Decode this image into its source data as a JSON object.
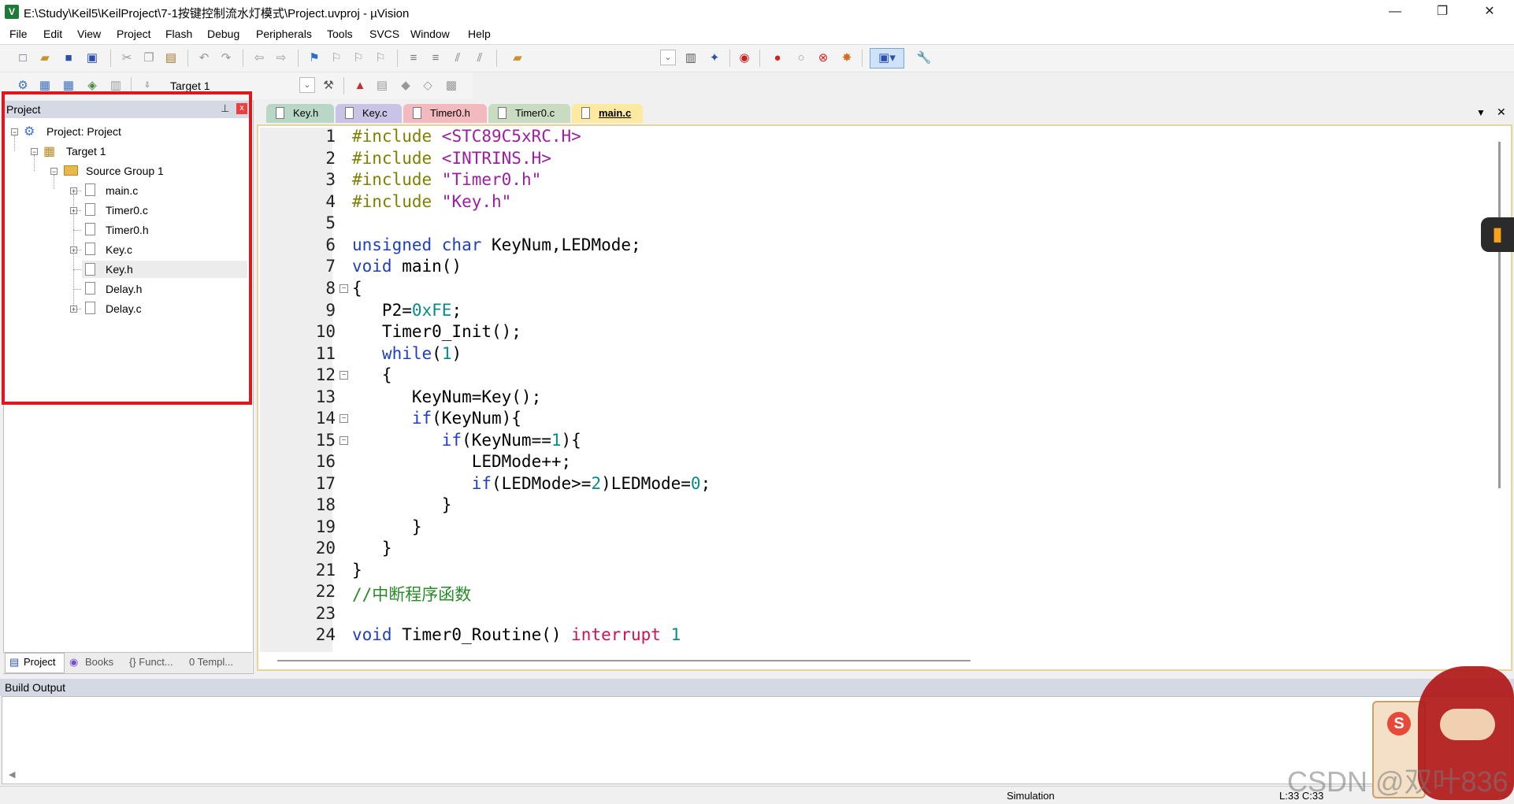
{
  "window": {
    "title": "E:\\Study\\Keil5\\KeilProject\\7-1按键控制流水灯模式\\Project.uvproj - µVision",
    "icon_label": "V",
    "minimize": "—",
    "restore": "❐",
    "close": "✕"
  },
  "menu": [
    "File",
    "Edit",
    "View",
    "Project",
    "Flash",
    "Debug",
    "Peripherals",
    "Tools",
    "SVCS",
    "Window",
    "Help"
  ],
  "toolbar2": {
    "target_select": "Target 1"
  },
  "project_panel": {
    "title": "Project",
    "pin": "⊥",
    "close": "x",
    "tree": {
      "root": "Project: Project",
      "target": "Target 1",
      "group": "Source Group 1",
      "files": [
        "main.c",
        "Timer0.c",
        "Timer0.h",
        "Key.c",
        "Key.h",
        "Delay.h",
        "Delay.c"
      ]
    },
    "tabs": [
      "Project",
      "Books",
      "{} Funct...",
      "0 Templ..."
    ]
  },
  "editor": {
    "tabs": [
      {
        "label": "Key.h",
        "color": "#b9d7c6"
      },
      {
        "label": "Key.c",
        "color": "#c9c3e6"
      },
      {
        "label": "Timer0.h",
        "color": "#f2b9bf"
      },
      {
        "label": "Timer0.c",
        "color": "#c9dcc1"
      },
      {
        "label": "main.c",
        "color": "#fde9a0"
      }
    ],
    "active_tab": "main.c",
    "dropdown": "▼",
    "close": "✕",
    "line_numbers": [
      "1",
      "2",
      "3",
      "4",
      "5",
      "6",
      "7",
      "8",
      "9",
      "10",
      "11",
      "12",
      "13",
      "14",
      "15",
      "16",
      "17",
      "18",
      "19",
      "20",
      "21",
      "22",
      "23",
      "24"
    ],
    "code": {
      "l1a": "#include ",
      "l1b": "<STC89C5xRC.H>",
      "l2a": "#include ",
      "l2b": "<INTRINS.H>",
      "l3a": "#include ",
      "l3b": "\"Timer0.h\"",
      "l4a": "#include ",
      "l4b": "\"Key.h\"",
      "l6a": "unsigned char",
      "l6b": " KeyNum,LEDMode;",
      "l7a": "void",
      "l7b": " main()",
      "l8": "{",
      "l9a": "   P2=",
      "l9b": "0xFE",
      "l9c": ";",
      "l10": "   Timer0_Init();",
      "l11a": "   while",
      "l11b": "(",
      "l11c": "1",
      "l11d": ")",
      "l12": "   {",
      "l13": "      KeyNum=Key();",
      "l14a": "      if",
      "l14b": "(KeyNum){",
      "l15a": "         if",
      "l15b": "(KeyNum==",
      "l15c": "1",
      "l15d": "){",
      "l16": "            LEDMode++;",
      "l17a": "            if",
      "l17b": "(LEDMode>=",
      "l17c": "2",
      "l17d": ")LEDMode=",
      "l17e": "0",
      "l17f": ";",
      "l18": "         }",
      "l19": "      }",
      "l20": "   }",
      "l21": "}",
      "l22": "//中断程序函数",
      "l24a": "void",
      "l24b": " Timer0_Routine() ",
      "l24c": "interrupt",
      "l24d": " 1"
    }
  },
  "build_output": {
    "title": "Build Output"
  },
  "statusbar": {
    "mode": "Simulation",
    "position": "L:33 C:33"
  },
  "watermark": "CSDN @双叶836"
}
